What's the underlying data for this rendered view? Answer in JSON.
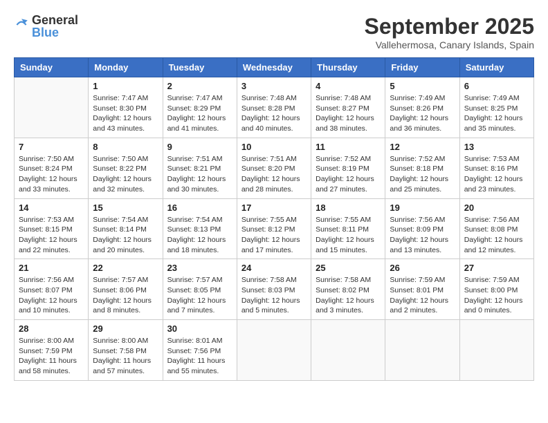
{
  "header": {
    "logo_general": "General",
    "logo_blue": "Blue",
    "month": "September 2025",
    "location": "Vallehermosa, Canary Islands, Spain"
  },
  "days_of_week": [
    "Sunday",
    "Monday",
    "Tuesday",
    "Wednesday",
    "Thursday",
    "Friday",
    "Saturday"
  ],
  "weeks": [
    [
      {
        "day": "",
        "sunrise": "",
        "sunset": "",
        "daylight": ""
      },
      {
        "day": "1",
        "sunrise": "Sunrise: 7:47 AM",
        "sunset": "Sunset: 8:30 PM",
        "daylight": "Daylight: 12 hours and 43 minutes."
      },
      {
        "day": "2",
        "sunrise": "Sunrise: 7:47 AM",
        "sunset": "Sunset: 8:29 PM",
        "daylight": "Daylight: 12 hours and 41 minutes."
      },
      {
        "day": "3",
        "sunrise": "Sunrise: 7:48 AM",
        "sunset": "Sunset: 8:28 PM",
        "daylight": "Daylight: 12 hours and 40 minutes."
      },
      {
        "day": "4",
        "sunrise": "Sunrise: 7:48 AM",
        "sunset": "Sunset: 8:27 PM",
        "daylight": "Daylight: 12 hours and 38 minutes."
      },
      {
        "day": "5",
        "sunrise": "Sunrise: 7:49 AM",
        "sunset": "Sunset: 8:26 PM",
        "daylight": "Daylight: 12 hours and 36 minutes."
      },
      {
        "day": "6",
        "sunrise": "Sunrise: 7:49 AM",
        "sunset": "Sunset: 8:25 PM",
        "daylight": "Daylight: 12 hours and 35 minutes."
      }
    ],
    [
      {
        "day": "7",
        "sunrise": "Sunrise: 7:50 AM",
        "sunset": "Sunset: 8:24 PM",
        "daylight": "Daylight: 12 hours and 33 minutes."
      },
      {
        "day": "8",
        "sunrise": "Sunrise: 7:50 AM",
        "sunset": "Sunset: 8:22 PM",
        "daylight": "Daylight: 12 hours and 32 minutes."
      },
      {
        "day": "9",
        "sunrise": "Sunrise: 7:51 AM",
        "sunset": "Sunset: 8:21 PM",
        "daylight": "Daylight: 12 hours and 30 minutes."
      },
      {
        "day": "10",
        "sunrise": "Sunrise: 7:51 AM",
        "sunset": "Sunset: 8:20 PM",
        "daylight": "Daylight: 12 hours and 28 minutes."
      },
      {
        "day": "11",
        "sunrise": "Sunrise: 7:52 AM",
        "sunset": "Sunset: 8:19 PM",
        "daylight": "Daylight: 12 hours and 27 minutes."
      },
      {
        "day": "12",
        "sunrise": "Sunrise: 7:52 AM",
        "sunset": "Sunset: 8:18 PM",
        "daylight": "Daylight: 12 hours and 25 minutes."
      },
      {
        "day": "13",
        "sunrise": "Sunrise: 7:53 AM",
        "sunset": "Sunset: 8:16 PM",
        "daylight": "Daylight: 12 hours and 23 minutes."
      }
    ],
    [
      {
        "day": "14",
        "sunrise": "Sunrise: 7:53 AM",
        "sunset": "Sunset: 8:15 PM",
        "daylight": "Daylight: 12 hours and 22 minutes."
      },
      {
        "day": "15",
        "sunrise": "Sunrise: 7:54 AM",
        "sunset": "Sunset: 8:14 PM",
        "daylight": "Daylight: 12 hours and 20 minutes."
      },
      {
        "day": "16",
        "sunrise": "Sunrise: 7:54 AM",
        "sunset": "Sunset: 8:13 PM",
        "daylight": "Daylight: 12 hours and 18 minutes."
      },
      {
        "day": "17",
        "sunrise": "Sunrise: 7:55 AM",
        "sunset": "Sunset: 8:12 PM",
        "daylight": "Daylight: 12 hours and 17 minutes."
      },
      {
        "day": "18",
        "sunrise": "Sunrise: 7:55 AM",
        "sunset": "Sunset: 8:11 PM",
        "daylight": "Daylight: 12 hours and 15 minutes."
      },
      {
        "day": "19",
        "sunrise": "Sunrise: 7:56 AM",
        "sunset": "Sunset: 8:09 PM",
        "daylight": "Daylight: 12 hours and 13 minutes."
      },
      {
        "day": "20",
        "sunrise": "Sunrise: 7:56 AM",
        "sunset": "Sunset: 8:08 PM",
        "daylight": "Daylight: 12 hours and 12 minutes."
      }
    ],
    [
      {
        "day": "21",
        "sunrise": "Sunrise: 7:56 AM",
        "sunset": "Sunset: 8:07 PM",
        "daylight": "Daylight: 12 hours and 10 minutes."
      },
      {
        "day": "22",
        "sunrise": "Sunrise: 7:57 AM",
        "sunset": "Sunset: 8:06 PM",
        "daylight": "Daylight: 12 hours and 8 minutes."
      },
      {
        "day": "23",
        "sunrise": "Sunrise: 7:57 AM",
        "sunset": "Sunset: 8:05 PM",
        "daylight": "Daylight: 12 hours and 7 minutes."
      },
      {
        "day": "24",
        "sunrise": "Sunrise: 7:58 AM",
        "sunset": "Sunset: 8:03 PM",
        "daylight": "Daylight: 12 hours and 5 minutes."
      },
      {
        "day": "25",
        "sunrise": "Sunrise: 7:58 AM",
        "sunset": "Sunset: 8:02 PM",
        "daylight": "Daylight: 12 hours and 3 minutes."
      },
      {
        "day": "26",
        "sunrise": "Sunrise: 7:59 AM",
        "sunset": "Sunset: 8:01 PM",
        "daylight": "Daylight: 12 hours and 2 minutes."
      },
      {
        "day": "27",
        "sunrise": "Sunrise: 7:59 AM",
        "sunset": "Sunset: 8:00 PM",
        "daylight": "Daylight: 12 hours and 0 minutes."
      }
    ],
    [
      {
        "day": "28",
        "sunrise": "Sunrise: 8:00 AM",
        "sunset": "Sunset: 7:59 PM",
        "daylight": "Daylight: 11 hours and 58 minutes."
      },
      {
        "day": "29",
        "sunrise": "Sunrise: 8:00 AM",
        "sunset": "Sunset: 7:58 PM",
        "daylight": "Daylight: 11 hours and 57 minutes."
      },
      {
        "day": "30",
        "sunrise": "Sunrise: 8:01 AM",
        "sunset": "Sunset: 7:56 PM",
        "daylight": "Daylight: 11 hours and 55 minutes."
      },
      {
        "day": "",
        "sunrise": "",
        "sunset": "",
        "daylight": ""
      },
      {
        "day": "",
        "sunrise": "",
        "sunset": "",
        "daylight": ""
      },
      {
        "day": "",
        "sunrise": "",
        "sunset": "",
        "daylight": ""
      },
      {
        "day": "",
        "sunrise": "",
        "sunset": "",
        "daylight": ""
      }
    ]
  ]
}
